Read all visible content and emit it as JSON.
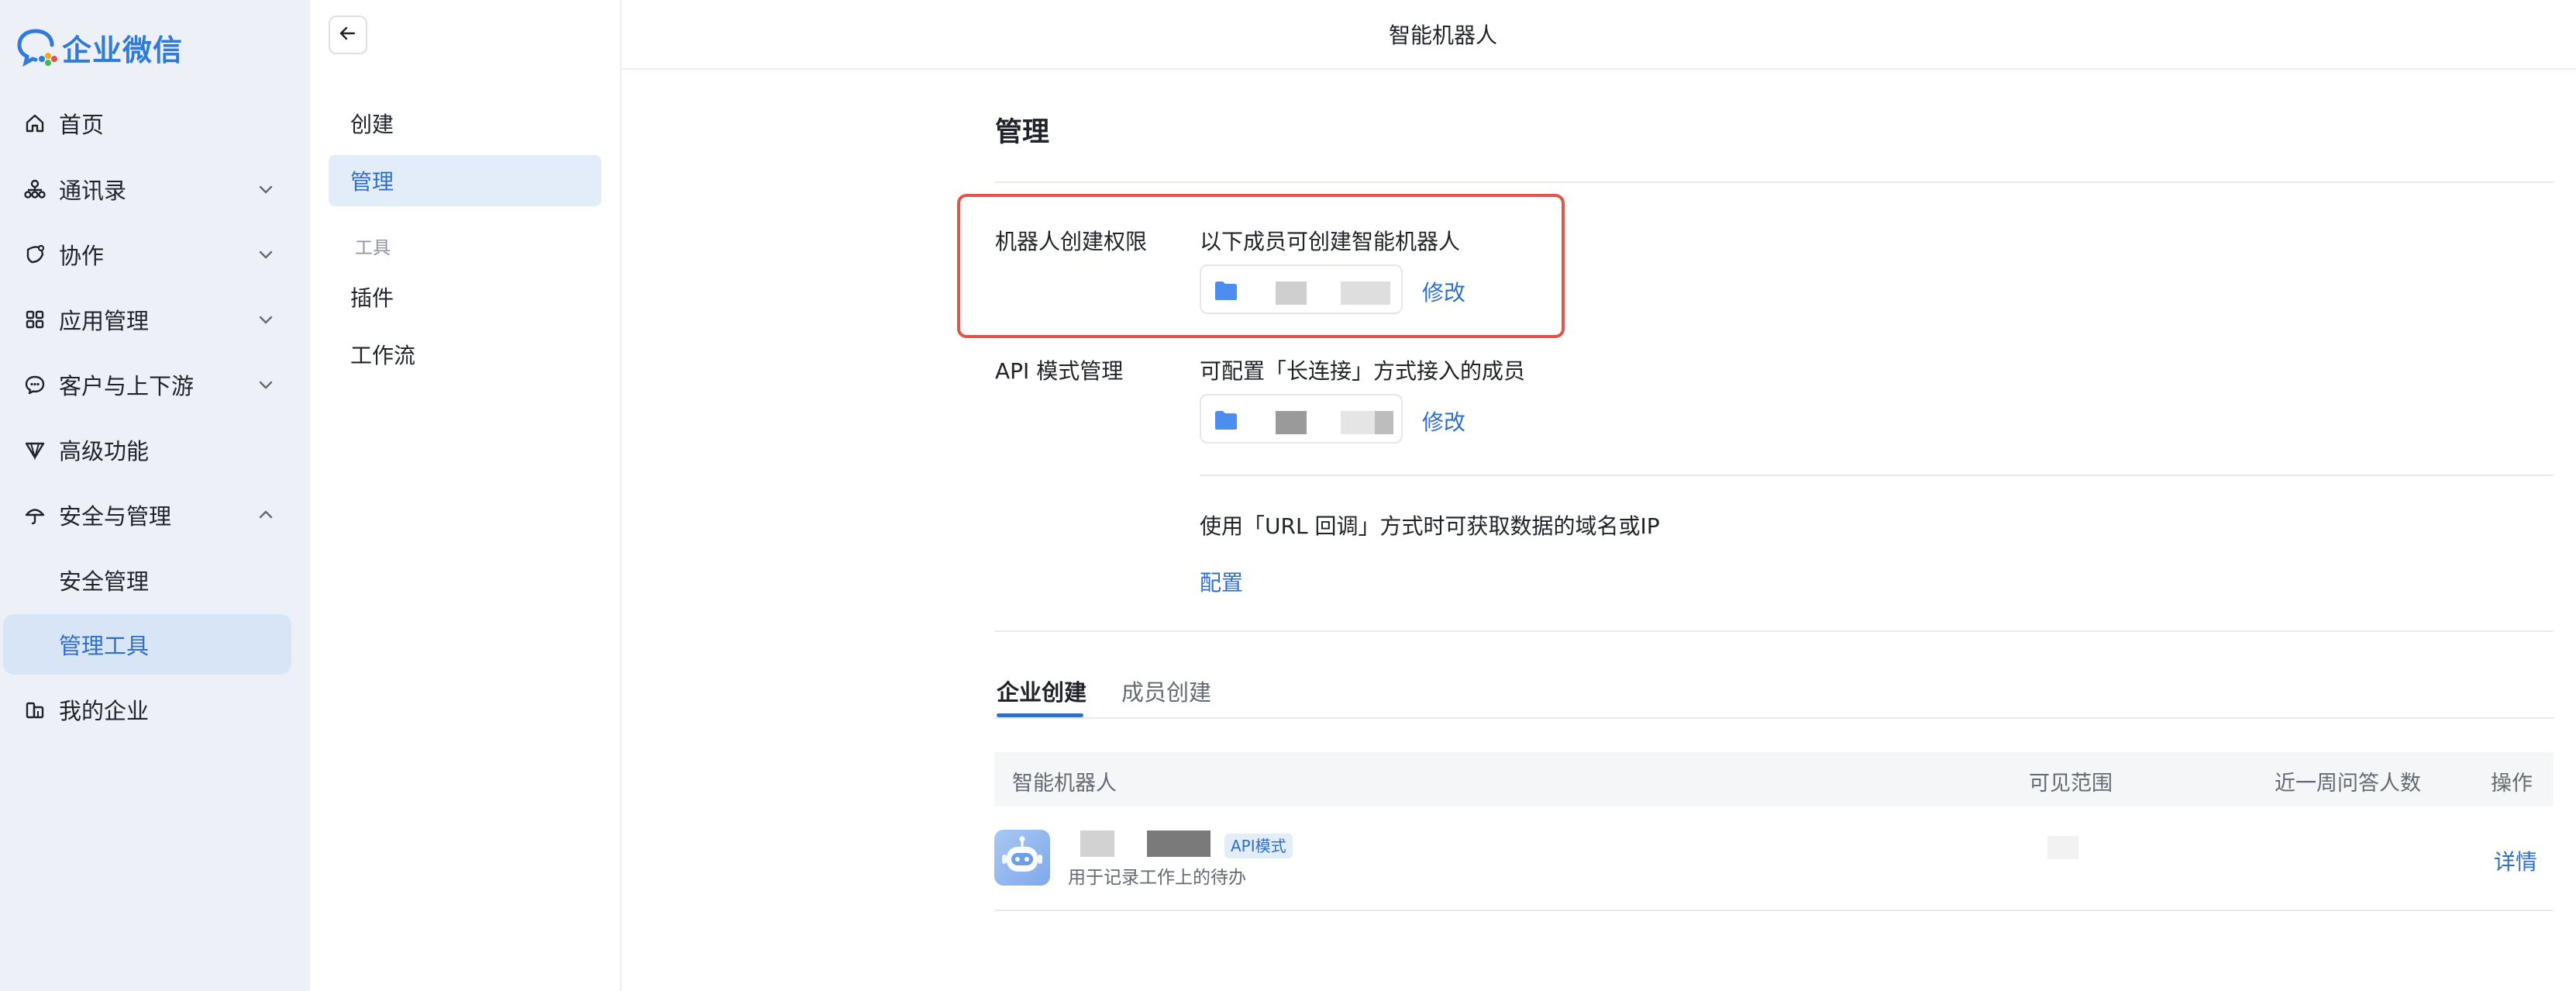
{
  "app": {
    "name": "企业微信",
    "page_title": "智能机器人"
  },
  "colors": {
    "accent": "#2f6fc9",
    "highlight_border": "#e0544a",
    "sidebar_bg": "#edf1f7"
  },
  "sidebar": {
    "items": [
      {
        "label": "首页",
        "icon": "home-icon"
      },
      {
        "label": "通讯录",
        "icon": "org-chart-icon",
        "chevron": "down"
      },
      {
        "label": "协作",
        "icon": "collaboration-icon",
        "chevron": "down"
      },
      {
        "label": "应用管理",
        "icon": "grid-icon",
        "chevron": "down"
      },
      {
        "label": "客户与上下游",
        "icon": "chat-bubble-icon",
        "chevron": "down"
      },
      {
        "label": "高级功能",
        "icon": "diamond-icon"
      },
      {
        "label": "安全与管理",
        "icon": "umbrella-icon",
        "chevron": "up"
      },
      {
        "label": "安全管理",
        "sub": true
      },
      {
        "label": "管理工具",
        "sub": true,
        "active": true
      },
      {
        "label": "我的企业",
        "icon": "building-icon"
      }
    ]
  },
  "secondary_nav": {
    "items": [
      {
        "label": "创建"
      },
      {
        "label": "管理",
        "active": true
      }
    ],
    "group_label": "工具",
    "group_items": [
      {
        "label": "插件"
      },
      {
        "label": "工作流"
      }
    ]
  },
  "main": {
    "title": "管理",
    "create_permission": {
      "label": "机器人创建权限",
      "desc": "以下成员可创建智能机器人",
      "modify": "修改"
    },
    "api_mode": {
      "label": "API 模式管理",
      "desc": "可配置「长连接」方式接入的成员",
      "modify": "修改"
    },
    "url_callback": {
      "desc": "使用「URL 回调」方式时可获取数据的域名或IP",
      "configure": "配置"
    },
    "tabs": [
      {
        "label": "企业创建",
        "active": true
      },
      {
        "label": "成员创建",
        "active": false
      }
    ],
    "table": {
      "headers": [
        "智能机器人",
        "可见范围",
        "近一周问答人数",
        "操作"
      ],
      "rows": [
        {
          "badge": "API模式",
          "desc": "用于记录工作上的待办",
          "action": "详情"
        }
      ]
    }
  }
}
